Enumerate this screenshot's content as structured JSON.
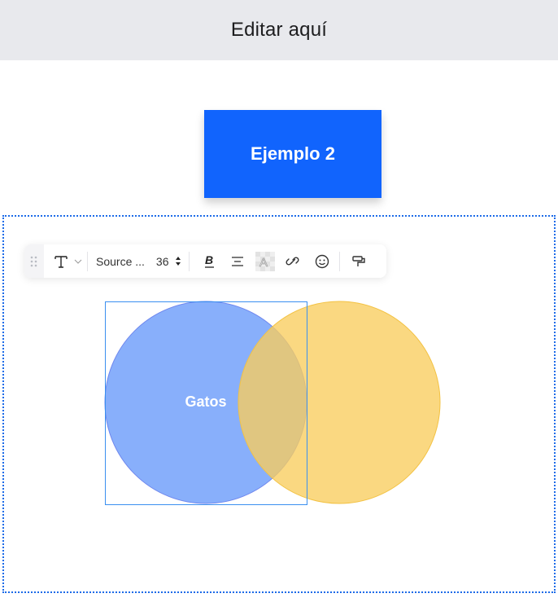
{
  "header": {
    "title": "Editar aquí"
  },
  "example_button": {
    "label": "Ejemplo 2",
    "color": "#1164fd"
  },
  "toolbar": {
    "drag_handle_icon": "drag-dots-icon",
    "text_type_icon": "text-T-icon",
    "font_family": "Source ...",
    "font_size": "36",
    "tools": [
      "bold",
      "align-center",
      "text-fill",
      "link",
      "emoji",
      "format-painter"
    ]
  },
  "venn": {
    "circles": [
      {
        "label": "Gatos",
        "color": "#6e9dfa",
        "stroke": "#6f87ee"
      },
      {
        "label": "",
        "color": "#f9cd5e",
        "stroke": "#f3c243"
      }
    ],
    "overlap_color": "#bdb183",
    "selection_color": "#3b8ff0"
  },
  "frame": {
    "border_color": "#1c6be8"
  }
}
